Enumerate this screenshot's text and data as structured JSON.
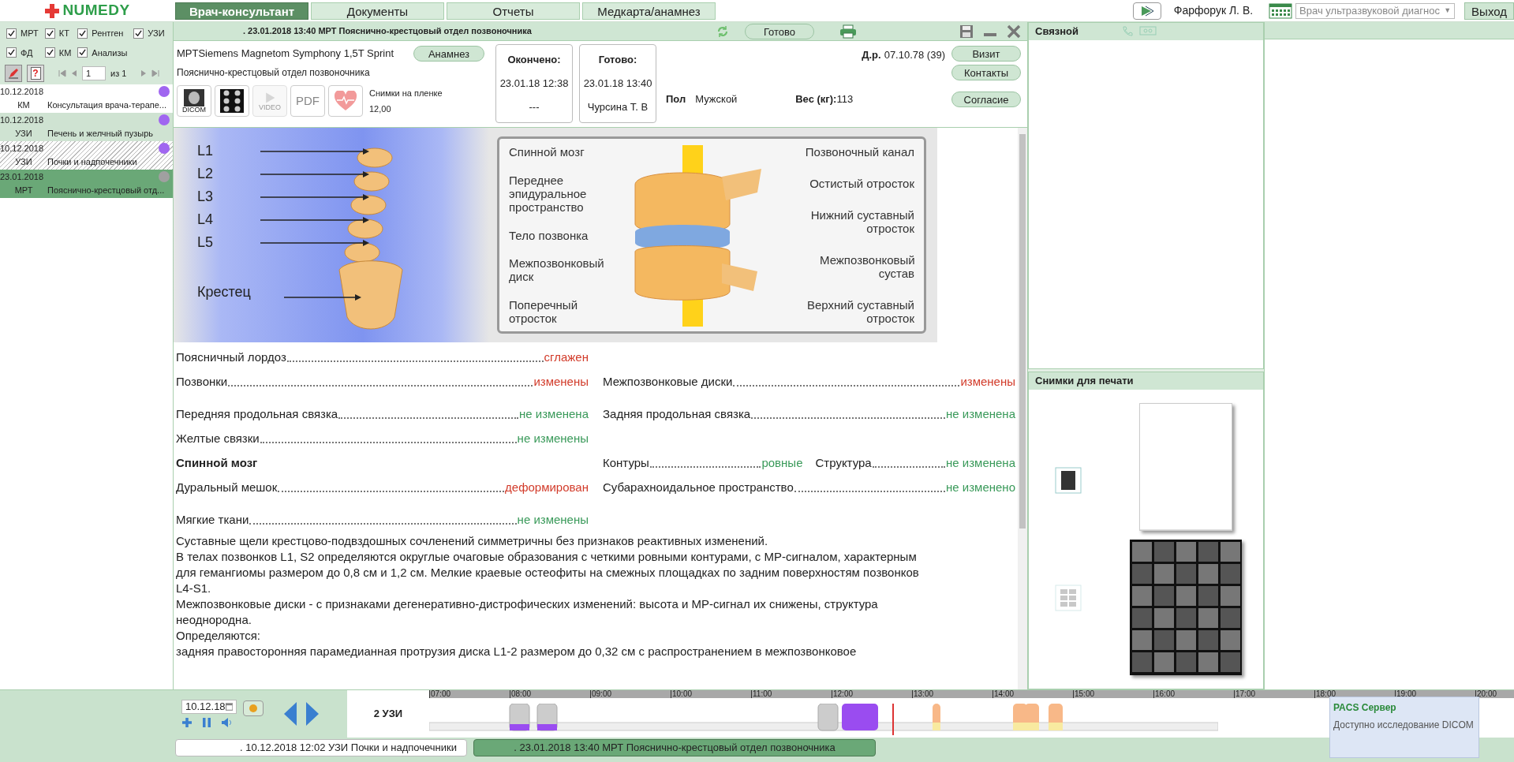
{
  "logo": {
    "text": "NUMEDY"
  },
  "tabs": [
    {
      "label": "Врач-консультант",
      "selected": true
    },
    {
      "label": "Документы",
      "selected": false
    },
    {
      "label": "Отчеты",
      "selected": false
    },
    {
      "label": "Медкарта/анамнез",
      "selected": false
    }
  ],
  "user": {
    "name": "Фарфорук Л. В.",
    "role": "Врач ультразвуковой диагнос",
    "role_arrow": "▼",
    "logout": "Выход"
  },
  "filters": [
    {
      "label": "МРТ",
      "checked": true
    },
    {
      "label": "КТ",
      "checked": true
    },
    {
      "label": "Рентген",
      "checked": true
    },
    {
      "label": "УЗИ",
      "checked": true
    },
    {
      "label": "ФД",
      "checked": true
    },
    {
      "label": "КМ",
      "checked": true
    },
    {
      "label": "Анализы",
      "checked": true
    }
  ],
  "pager": {
    "page": "1",
    "of": "из 1"
  },
  "help_glyph": "?",
  "studies": [
    {
      "date": "10.12.2018",
      "type": "КМ",
      "name": "Консультация врача-терапе...",
      "color": "#a066f0",
      "hatched": false,
      "selected": false
    },
    {
      "date": "10.12.2018",
      "type": "УЗИ",
      "name": "Печень и желчный пузырь",
      "color": "#a066f0",
      "hatched": false,
      "selected": false
    },
    {
      "date": "10.12.2018",
      "type": "УЗИ",
      "name": "Почки и надпочечники",
      "color": "#a066f0",
      "hatched": true,
      "selected": false
    },
    {
      "date": "23.01.2018",
      "type": "МРТ",
      "name": "Пояснично-крестцовый отд...",
      "color": "#a0a0a0",
      "hatched": false,
      "selected": true
    }
  ],
  "study": {
    "title": ". 23.01.2018 13:40 МРТ Пояснично-крестцовый отдел позвоночника",
    "ready_button": "Готово",
    "device": "MPTSiemens Magnetom Symphony 1,5T Sprint",
    "anamnesis_button": "Анамнез",
    "region": "Пояснично-крестцовый отдел позвоночника",
    "media": [
      {
        "kind": "dicom",
        "label": "DICOM",
        "disabled": false
      },
      {
        "kind": "grid",
        "disabled": false
      },
      {
        "kind": "video",
        "label": "VIDEO",
        "disabled": true
      },
      {
        "kind": "pdf",
        "label": "PDF",
        "disabled": false
      },
      {
        "kind": "heart",
        "disabled": false
      }
    ],
    "film_label": "Снимки на пленке",
    "film_value": "12,00",
    "finished": {
      "label": "Окончено:",
      "time": "23.01.18 12:38",
      "by": "---"
    },
    "ready": {
      "label": "Готово:",
      "time": "23.01.18 13:40",
      "by": "Чурсина Т. В"
    },
    "sex_label": "Пол",
    "sex": "Мужской",
    "birth_label": "Д.р.",
    "birth": "07.10.78 (39)",
    "weight_label": "Вес (кг):",
    "weight": "113",
    "buttons": [
      "Визит",
      "Контакты",
      "Согласие"
    ]
  },
  "illustration": {
    "spine_labels": [
      "L1",
      "L2",
      "L3",
      "L4",
      "L5"
    ],
    "sacrum_label": "Крестец",
    "inset_left": [
      "Спинной мозг",
      "Переднее эпидуральное пространство",
      "Тело позвонка",
      "Межпозвонковый диск",
      "Поперечный отросток"
    ],
    "inset_right": [
      "Позвоночный канал",
      "Остистый отросток",
      "Нижний суставный отросток",
      "Межпозвонковый сустав",
      "Верхний суставный отросток"
    ]
  },
  "findings": [
    [
      {
        "kind": "field",
        "label": "Поясничный лордоз",
        "value": "сглажен",
        "abnormal": true
      }
    ],
    [
      {
        "kind": "field",
        "label": "Позвонки",
        "value": "изменены",
        "abnormal": true
      },
      {
        "kind": "field",
        "label": "Межпозвонковые диски",
        "value": "изменены",
        "abnormal": true
      }
    ],
    [
      {
        "kind": "field",
        "label": "Передняя продольная связка",
        "value": "не изменена",
        "abnormal": false
      },
      {
        "kind": "field",
        "label": "Задняя продольная связка",
        "value": "не изменена",
        "abnormal": false
      }
    ],
    [
      {
        "kind": "field",
        "label": "Желтые связки",
        "value": "не изменены",
        "abnormal": false
      }
    ],
    [
      {
        "kind": "heading",
        "label": "Спинной мозг"
      },
      {
        "kind": "pair",
        "label": "Контуры",
        "value": "ровные",
        "abnormal": false,
        "label2": "Структура",
        "value2": "не изменена",
        "abnormal2": false
      }
    ],
    [
      {
        "kind": "field",
        "label": "Дуральный мешок",
        "value": "деформирован",
        "abnormal": true
      },
      {
        "kind": "field",
        "label": "Субарахноидальное пространство",
        "value": "не изменено",
        "abnormal": false
      }
    ],
    [
      {
        "kind": "field",
        "label": "Мягкие ткани",
        "value": "не изменены",
        "abnormal": false
      }
    ]
  ],
  "report": [
    "Суставные щели крестцово-подвздошных сочленений  симметричны без признаков реактивных изменений.",
    "В телах позвонков L1, S2 определяются округлые очаговые образования с четкими ровными контурами, с МР-сигналом, характерным для гемангиомы  размером до 0,8 см и 1,2 см.  Мелкие краевые остеофиты на смежных площадках по задним поверхностям  позвонков L4-S1.",
    "Межпозвонковые диски - с  признаками  дегенеративно-дистрофических изменений: высота и МР-сигнал  их  снижены,  структура неоднородна.",
    "Определяются:",
    "задняя правосторонняя парамедианная протрузия диска L1-2 размером до 0,32 см с распространением в межпозвонковое"
  ],
  "contact_panel": {
    "title": "Связной"
  },
  "print_panel": {
    "title": "Снимки для печати"
  },
  "schedule": {
    "date": "10.12.18",
    "room": "2 УЗИ",
    "hours": [
      "07:00",
      "08:00",
      "09:00",
      "10:00",
      "11:00",
      "12:00",
      "13:00",
      "14:00",
      "15:00",
      "16:00",
      "17:00",
      "18:00",
      "19:00",
      "20:00"
    ]
  },
  "open_studies": [
    {
      "label": ". 10.12.2018 12:02 УЗИ Почки и надпочечники",
      "selected": false
    },
    {
      "label": ". 23.01.2018 13:40 МРТ Пояснично-крестцовый отдел позвоночника",
      "selected": true
    }
  ],
  "notification": {
    "title": "PACS Сервер",
    "text": "Доступно исследование DICOM"
  }
}
